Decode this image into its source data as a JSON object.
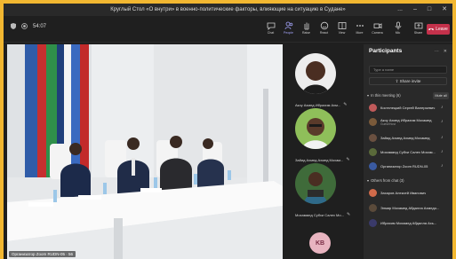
{
  "window": {
    "title": "Круглый Стол «О внутри» в военно-политические факторы, влияющие на ситуацию в Судане»",
    "controls": [
      "...",
      "–",
      "□",
      "✕"
    ]
  },
  "toolbar": {
    "timer": "54:07",
    "tools": [
      {
        "label": "Chat",
        "icon": "chat-icon"
      },
      {
        "label": "People",
        "icon": "people-icon",
        "count": "1"
      },
      {
        "label": "Raise",
        "icon": "raise-hand-icon"
      },
      {
        "label": "React",
        "icon": "react-icon"
      },
      {
        "label": "View",
        "icon": "view-icon"
      },
      {
        "label": "More",
        "icon": "more-icon"
      }
    ],
    "media": [
      {
        "label": "Camera",
        "icon": "camera-icon"
      },
      {
        "label": "Mic",
        "icon": "mic-icon"
      },
      {
        "label": "Share",
        "icon": "share-icon"
      }
    ],
    "leave_label": "Leave"
  },
  "stage": {
    "caption": "Организатор Zoom RUDN-05 · 56"
  },
  "gallery": {
    "tiles": [
      {
        "name": "Акоу Ахмед Ибрахим Ахм..."
      },
      {
        "name": "Зайид Ахмед Ахмед Мохам..."
      },
      {
        "name": "Мохаммед Субхи Салех Мо..."
      }
    ],
    "kb_initials": "KB"
  },
  "participants": {
    "title": "Participants",
    "search_placeholder": "Type a name",
    "share_invite": "Share invite",
    "in_meeting_label": "In this meeting (6)",
    "mute_all": "Mute all",
    "others_label": "Others from chat (3)",
    "in_meeting": [
      {
        "name": "Костелецкий Сергей Валерьевич",
        "sub": "",
        "initials": "КС",
        "color": "#c05a5a"
      },
      {
        "name": "Акоу Ахмед Ибрахим Мохамед",
        "sub": "Guest/Host",
        "initials": "АА",
        "color": "#7a5a3a"
      },
      {
        "name": "Зайид Ахмед Ахмед Мохамед",
        "sub": "",
        "initials": "ЗА",
        "color": "#6a5040"
      },
      {
        "name": "Мохаммед Субхи Салех Мохам...",
        "sub": "",
        "initials": "МС",
        "color": "#5a6a3a"
      },
      {
        "name": "Организатор Zoom RUDN-05",
        "sub": "",
        "initials": "ОZ",
        "color": "#3a5aa0"
      }
    ],
    "others": [
      {
        "name": "Захаров Алексей Иванович",
        "sub": "",
        "initials": "ЗА",
        "color": "#d06a4a"
      },
      {
        "name": "Элмир Мохамед Абдалла Ахмедо...",
        "sub": "",
        "initials": "ЭМ",
        "color": "#5a4a3a"
      },
      {
        "name": "Ибрахим Мохамед Абдалла Ахь...",
        "sub": "",
        "initials": "ИМ",
        "color": "#3a3a6a"
      }
    ]
  }
}
